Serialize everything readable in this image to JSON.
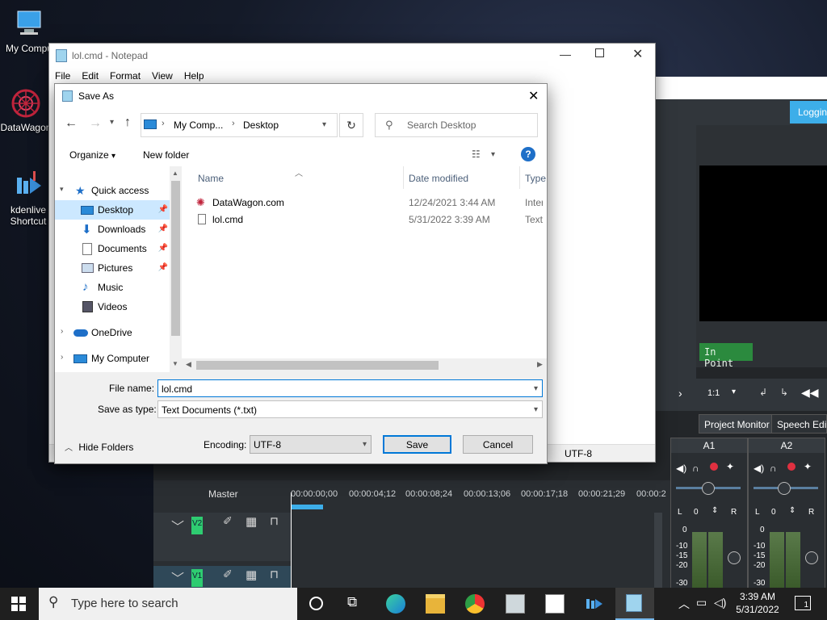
{
  "desktop": {
    "icons": [
      {
        "label": "My Compu"
      },
      {
        "label": "DataWagon"
      },
      {
        "label": "kdenlive Shortcut"
      }
    ]
  },
  "kdenlive": {
    "logging_tab": "Loggin",
    "in_point": "In Point",
    "zoom": "1:1",
    "tabs": [
      "Project Monitor",
      "Speech Editor"
    ],
    "master": "Master",
    "ruler_ticks": [
      "00:00:00;00",
      "00:00:04;12",
      "00:00:08;24",
      "00:00:13;06",
      "00:00:17;18",
      "00:00:21;29",
      "00:00:2"
    ],
    "tracks": [
      "V2",
      "V1"
    ],
    "mixers": [
      {
        "name": "A1",
        "left_label": "L",
        "value": "0",
        "right_label": "R",
        "levels": [
          "0",
          "-10",
          "-15",
          "-20",
          "-30"
        ]
      },
      {
        "name": "A2",
        "left_label": "L",
        "value": "0",
        "right_label": "R",
        "levels": [
          "0",
          "-10",
          "-15",
          "-20",
          "-30"
        ]
      }
    ]
  },
  "notepad": {
    "title": "lol.cmd - Notepad",
    "menu": [
      "File",
      "Edit",
      "Format",
      "View",
      "Help"
    ],
    "status_encoding": "UTF-8"
  },
  "dialog": {
    "title": "Save As",
    "breadcrumb": [
      "My Comp...",
      "Desktop"
    ],
    "search_placeholder": "Search Desktop",
    "organize": "Organize",
    "new_folder": "New folder",
    "tree": [
      {
        "label": "Quick access",
        "level": 0,
        "pinned": false
      },
      {
        "label": "Desktop",
        "level": 1,
        "pinned": true,
        "selected": true
      },
      {
        "label": "Downloads",
        "level": 1,
        "pinned": true
      },
      {
        "label": "Documents",
        "level": 1,
        "pinned": true
      },
      {
        "label": "Pictures",
        "level": 1,
        "pinned": true
      },
      {
        "label": "Music",
        "level": 1,
        "pinned": false
      },
      {
        "label": "Videos",
        "level": 1,
        "pinned": false
      },
      {
        "label": "OneDrive",
        "level": 0,
        "pinned": false
      },
      {
        "label": "My Computer",
        "level": 0,
        "pinned": false
      }
    ],
    "columns": {
      "name": "Name",
      "date": "Date modified",
      "type": "Type"
    },
    "files": [
      {
        "name": "DataWagon.com",
        "date": "12/24/2021 3:44 AM",
        "type": "Intern"
      },
      {
        "name": "lol.cmd",
        "date": "5/31/2022 3:39 AM",
        "type": "Text D"
      }
    ],
    "file_name_label": "File name:",
    "file_name_value": "lol.cmd",
    "save_type_label": "Save as type:",
    "save_type_value": "Text Documents (*.txt)",
    "hide_folders": "Hide Folders",
    "encoding_label": "Encoding:",
    "encoding_value": "UTF-8",
    "save": "Save",
    "cancel": "Cancel"
  },
  "taskbar": {
    "search_placeholder": "Type here to search",
    "time": "3:39 AM",
    "date": "5/31/2022",
    "notifications": "1"
  },
  "colors": {
    "accent": "#0078d7",
    "selection": "#cce8ff",
    "kdenlive_bg": "#232629",
    "in_point": "#2b8a3e"
  }
}
